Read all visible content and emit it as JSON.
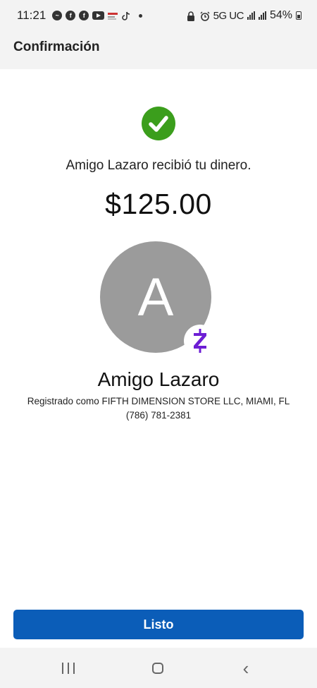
{
  "status_bar": {
    "time": "11:21",
    "network": "5G UC",
    "battery": "54%"
  },
  "header": {
    "title": "Confirmación"
  },
  "confirmation": {
    "message": "Amigo Lazaro recibió tu dinero.",
    "amount": "$125.00",
    "avatar_initial": "A",
    "recipient_name": "Amigo Lazaro",
    "registered_as": "Registrado como FIFTH DIMENSION STORE LLC, MIAMI, FL",
    "phone": "(786) 781-2381"
  },
  "actions": {
    "done_label": "Listo"
  },
  "colors": {
    "primary_button": "#0b5db8",
    "success_check": "#3b9e1c",
    "zelle_purple": "#6d1ed4",
    "avatar_bg": "#9b9b9b"
  },
  "icons": {
    "success": "check-circle-icon",
    "badge": "zelle-logo-icon",
    "nav": [
      "recents-icon",
      "home-icon",
      "back-icon"
    ]
  }
}
